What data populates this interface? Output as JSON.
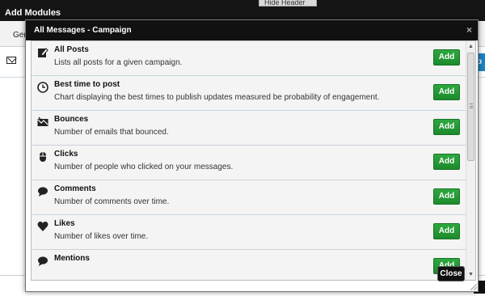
{
  "background": {
    "title": "Add Modules",
    "hide_header": "Hide Header",
    "tab": "Gen",
    "blue_button": "p"
  },
  "modal": {
    "title": "All Messages - Campaign",
    "close_x": "×",
    "close_label": "Close",
    "modules": [
      {
        "name": "All Posts",
        "desc": "Lists all posts for a given campaign.",
        "icon": "edit-icon",
        "button": "Add"
      },
      {
        "name": "Best time to post",
        "desc": "Chart displaying the best times to publish updates measured be probability of engagement.",
        "icon": "clock-icon",
        "button": "Add"
      },
      {
        "name": "Bounces",
        "desc": "Number of emails that bounced.",
        "icon": "bounce-icon",
        "button": "Add"
      },
      {
        "name": "Clicks",
        "desc": "Number of people who clicked on your messages.",
        "icon": "mouse-icon",
        "button": "Add"
      },
      {
        "name": "Comments",
        "desc": "Number of comments over time.",
        "icon": "comment-icon",
        "button": "Add"
      },
      {
        "name": "Likes",
        "desc": "Number of likes over time.",
        "icon": "heart-icon",
        "button": "Add"
      },
      {
        "name": "Mentions",
        "desc": "",
        "icon": "mention-icon",
        "button": "Add"
      }
    ]
  }
}
